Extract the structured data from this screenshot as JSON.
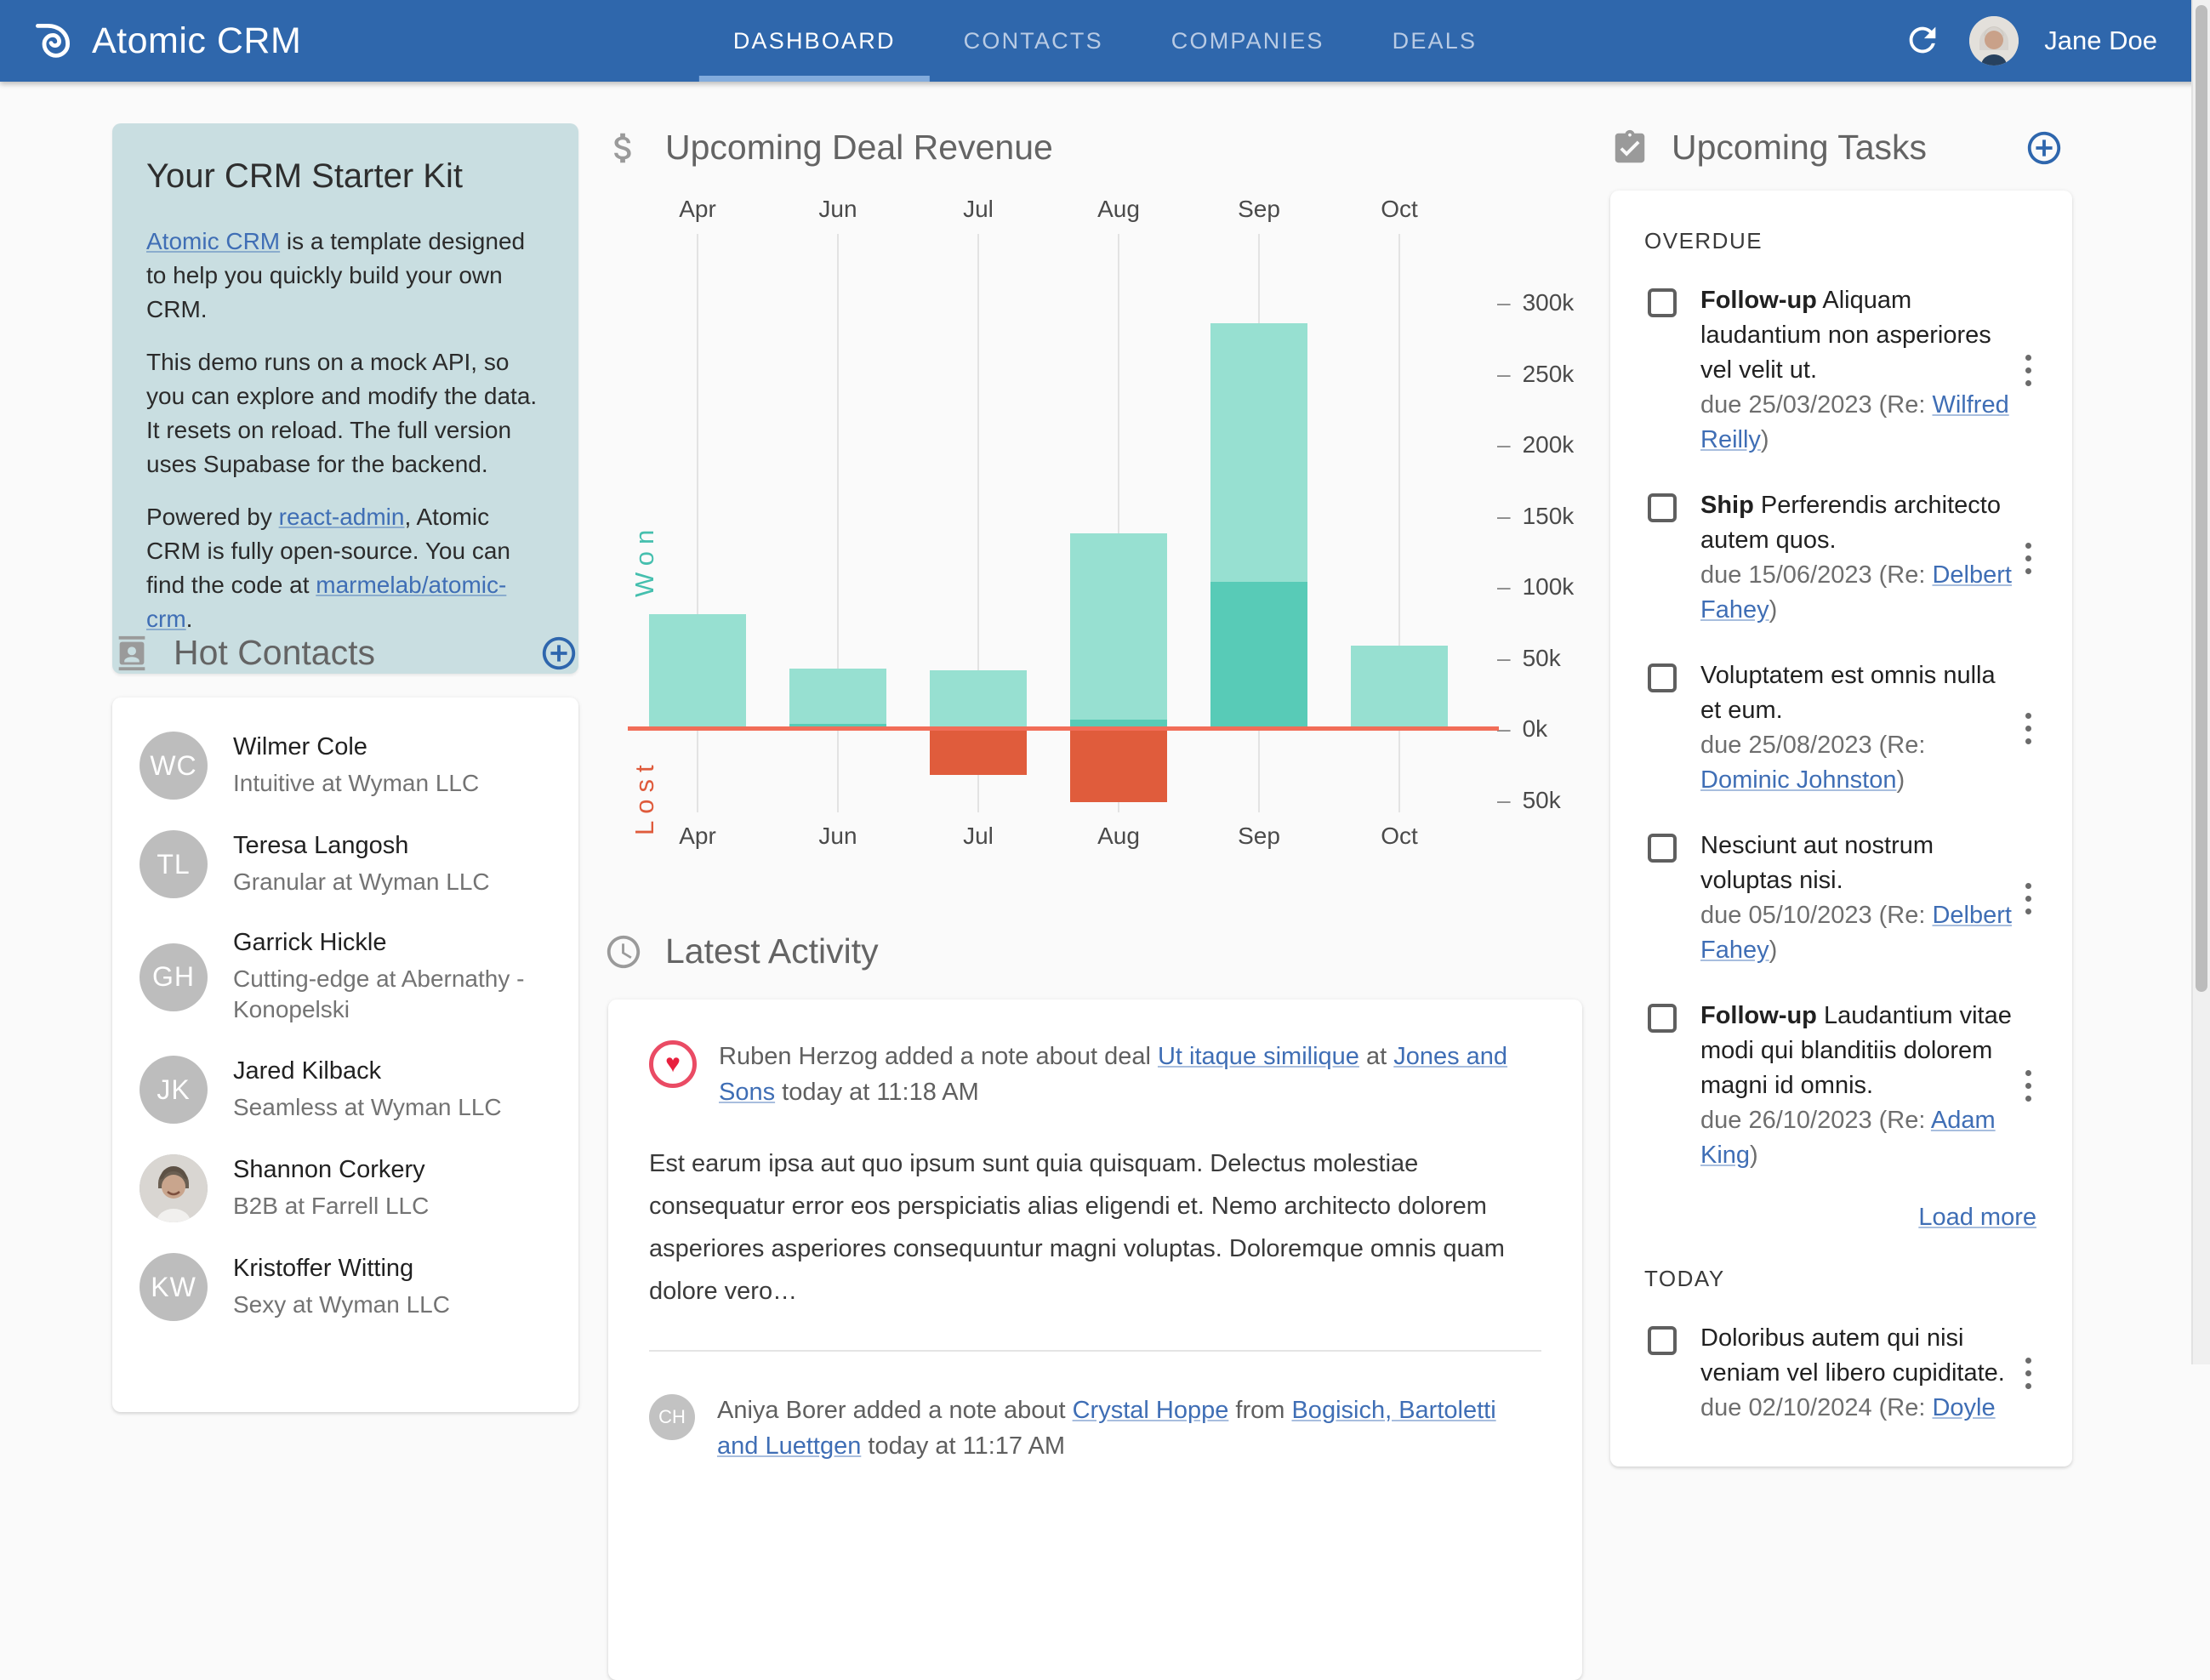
{
  "header": {
    "brand": "Atomic CRM",
    "tabs": [
      {
        "label": "DASHBOARD"
      },
      {
        "label": "CONTACTS"
      },
      {
        "label": "COMPANIES"
      },
      {
        "label": "DEALS"
      }
    ],
    "user": "Jane Doe",
    "nav_blue": "#2f67ac"
  },
  "starter_kit": {
    "title": "Your CRM Starter Kit",
    "p1_link": "Atomic CRM",
    "p1_rest": " is a template designed to help you quickly build your own CRM.",
    "p2": "This demo runs on a mock API, so you can explore and modify the data. It resets on reload. The full version uses Supabase for the backend.",
    "p3_prefix": "Powered by ",
    "p3_link1": "react-admin",
    "p3_mid": ", Atomic CRM is fully open-source. You can find the code at ",
    "p3_link2": "marmelab/atomic-crm",
    "p3_suffix": "."
  },
  "hot_contacts": {
    "title": "Hot Contacts",
    "contacts": [
      {
        "initials": "WC",
        "name": "Wilmer Cole",
        "subtitle": "Intuitive at Wyman LLC"
      },
      {
        "initials": "TL",
        "name": "Teresa Langosh",
        "subtitle": "Granular at Wyman LLC"
      },
      {
        "initials": "GH",
        "name": "Garrick Hickle",
        "subtitle": "Cutting-edge at Abernathy - Konopelski"
      },
      {
        "initials": "JK",
        "name": "Jared Kilback",
        "subtitle": "Seamless at Wyman LLC"
      },
      {
        "initials": "",
        "name": "Shannon Corkery",
        "subtitle": "B2B at Farrell LLC"
      },
      {
        "initials": "KW",
        "name": "Kristoffer Witting",
        "subtitle": "Sexy at Wyman LLC"
      }
    ]
  },
  "chart_data": {
    "type": "bar",
    "title": "Upcoming Deal Revenue",
    "categories": [
      "Apr",
      "Jun",
      "Jul",
      "Aug",
      "Sep",
      "Oct"
    ],
    "series": [
      {
        "name": "won-expected",
        "color": "#97e0d1",
        "values": [
          80000,
          39000,
          41000,
          131000,
          182000,
          58000
        ]
      },
      {
        "name": "won-closed",
        "color": "#58cbb7",
        "values": [
          0,
          3000,
          0,
          6000,
          103000,
          0
        ]
      },
      {
        "name": "lost",
        "color": "#e05c3c",
        "values": [
          0,
          0,
          -33000,
          -52000,
          0,
          0
        ]
      }
    ],
    "ylim": [
      -60000,
      330000
    ],
    "yticks": [
      "300k",
      "250k",
      "200k",
      "150k",
      "100k",
      "50k",
      "0k",
      "50k"
    ],
    "left_labels": {
      "won": "Won",
      "lost": "Lost"
    },
    "zero_line_color": "#f16d58",
    "legend": "none",
    "grid": "vertical"
  },
  "activity": {
    "title": "Latest Activity",
    "items": [
      {
        "text1": "Ruben Herzog added a note about deal ",
        "link1": "Ut itaque similique",
        "mid": " at ",
        "link2": "Jones and Sons",
        "time": " today at 11:18 AM",
        "note": "Est earum ipsa aut quo ipsum sunt quia quisquam. Delectus molestiae consequatur error eos perspiciatis alias eligendi et. Nemo architecto dolorem asperiores asperiores consequuntur magni voluptas. Doloremque omnis quam dolore vero…"
      },
      {
        "avatar": "CH",
        "text1": "Aniya Borer added a note about ",
        "link1": "Crystal Hoppe",
        "mid": " from ",
        "link2": "Bogisich, Bartoletti and Luettgen",
        "time": " today at 11:17 AM"
      }
    ]
  },
  "tasks": {
    "title": "Upcoming Tasks",
    "load_more": "Load more",
    "sections": [
      {
        "label": "OVERDUE",
        "tasks": [
          {
            "prefix": "Follow-up",
            "text": " Aliquam laudantium non asperiores vel velit ut.",
            "due": "due 25/03/2023 (Re: ",
            "contact": "Wilfred Reilly",
            "after": ")"
          },
          {
            "prefix": "Ship",
            "text": " Perferendis architecto autem quos.",
            "due": "due 15/06/2023 (Re: ",
            "contact": "Delbert Fahey",
            "after": ")"
          },
          {
            "prefix": "",
            "text": "Voluptatem est omnis nulla et eum.",
            "due": "due 25/08/2023 (Re: ",
            "contact": "Dominic Johnston",
            "after": ")"
          },
          {
            "prefix": "",
            "text": "Nesciunt aut nostrum voluptas nisi.",
            "due": "due 05/10/2023 (Re: ",
            "contact": "Delbert Fahey",
            "after": ")"
          },
          {
            "prefix": "Follow-up",
            "text": " Laudantium vitae modi qui blanditiis dolorem magni id omnis.",
            "due": "due 26/10/2023 (Re: ",
            "contact": "Adam King",
            "after": ")"
          }
        ]
      },
      {
        "label": "TODAY",
        "tasks": [
          {
            "prefix": "",
            "text": "Doloribus autem qui nisi veniam vel libero cupiditate.",
            "due": "due 02/10/2024 (Re: ",
            "contact": "Doyle",
            "after": ""
          }
        ]
      }
    ]
  }
}
